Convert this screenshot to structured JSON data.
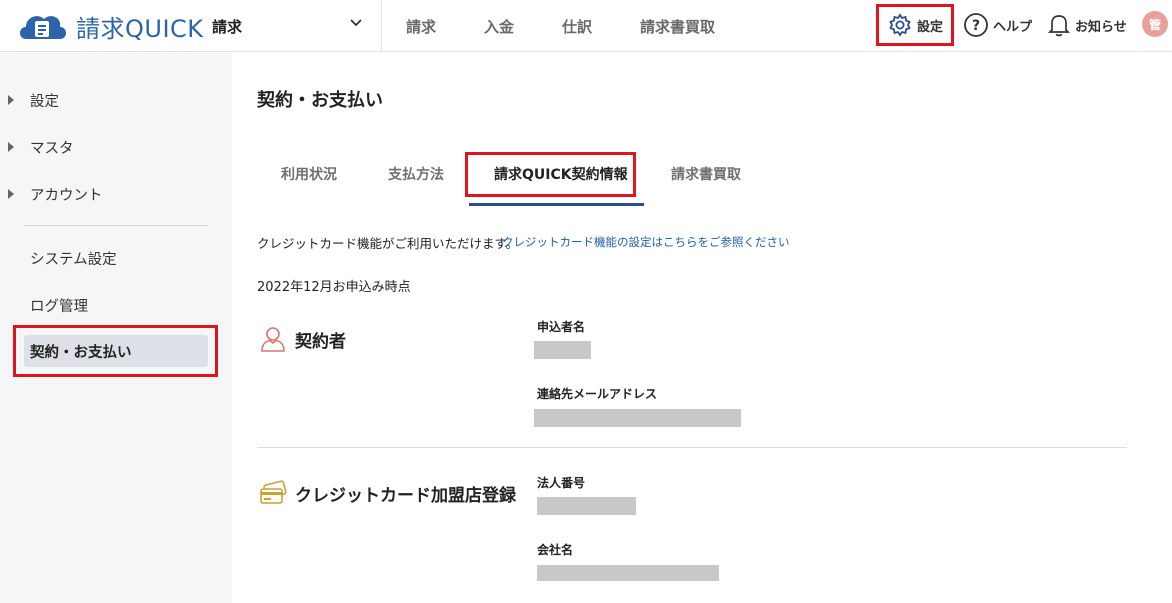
{
  "header": {
    "logo_text": "請求QUICK",
    "product_select": "請求",
    "nav": [
      "請求",
      "入金",
      "仕訳",
      "請求書買取"
    ],
    "settings_label": "設定",
    "help_label": "ヘルプ",
    "notice_label": "お知らせ",
    "avatar_text": "管"
  },
  "sidebar": {
    "settings": "設定",
    "master": "マスタ",
    "account": "アカウント",
    "system_settings": "システム設定",
    "log_management": "ログ管理",
    "contract_payment": "契約・お支払い"
  },
  "main": {
    "title": "契約・お支払い",
    "tabs": [
      "利用状況",
      "支払方法",
      "請求QUICK契約情報",
      "請求書買取"
    ],
    "note": "クレジットカード機能がご利用いただけます。",
    "note_link": "クレジットカード機能の設定はこちらをご参照ください",
    "date_line": "2022年12月お申込み時点",
    "contractor": {
      "title": "契約者",
      "applicant_label": "申込者名",
      "email_label": "連絡先メールアドレス"
    },
    "credit": {
      "title": "クレジットカード加盟店登録",
      "corp_no_label": "法人番号",
      "company_label": "会社名"
    }
  },
  "colors": {
    "brand": "#2b64a8",
    "highlight": "#e0141e",
    "tab_underline": "#2b4f8c",
    "link": "#2360a5"
  }
}
